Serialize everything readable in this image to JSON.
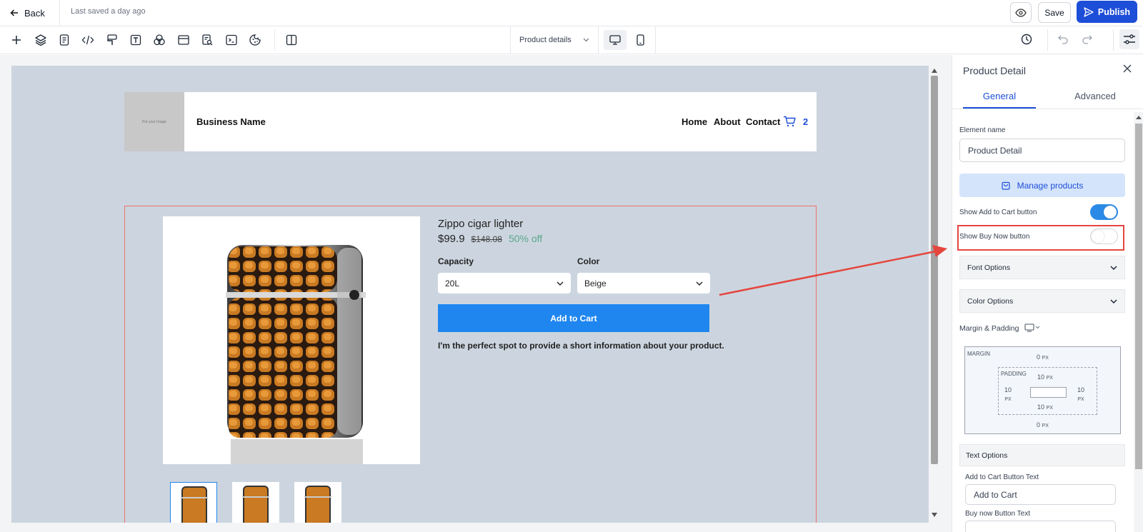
{
  "topbar": {
    "back_label": "Back",
    "last_saved": "Last saved a day ago",
    "save_label": "Save",
    "publish_label": "Publish"
  },
  "toolbar": {
    "tools": [
      "add-icon",
      "layers-icon",
      "pages-icon",
      "code-icon",
      "paint-icon",
      "text-icon",
      "colors-icon",
      "layout-icon",
      "seo-icon",
      "terminal-icon",
      "cookie-icon",
      "split-view-icon"
    ],
    "page_select": "Product details"
  },
  "site": {
    "logo_text": "Put your Image",
    "business_name": "Business Name",
    "nav": [
      "Home",
      "About",
      "Contact"
    ],
    "cart_count": "2"
  },
  "product": {
    "title": "Zippo cigar lighter",
    "price": "$99.9",
    "old_price": "$148.08",
    "discount": "50% off",
    "capacity_label": "Capacity",
    "capacity_value": "20L",
    "color_label": "Color",
    "color_value": "Beige",
    "add_to_cart": "Add to Cart",
    "description": "I'm the perfect spot to provide a short information about your product."
  },
  "panel": {
    "title": "Product Detail",
    "tabs": [
      "General",
      "Advanced"
    ],
    "element_name_label": "Element name",
    "element_name_value": "Product Detail",
    "manage_products": "Manage products",
    "show_add_to_cart": "Show Add to Cart button",
    "show_add_to_cart_on": true,
    "show_buy_now": "Show Buy Now button",
    "show_buy_now_on": false,
    "font_options": "Font Options",
    "color_options": "Color Options",
    "margin_padding": "Margin & Padding",
    "margin_label": "MARGIN",
    "padding_label": "PADDING",
    "margin_top": "0",
    "margin_bottom": "0",
    "padding_top": "10",
    "padding_bottom": "10",
    "padding_left": "10",
    "padding_right": "10",
    "unit": "PX",
    "text_options": "Text Options",
    "add_to_cart_text_label": "Add to Cart Button Text",
    "add_to_cart_text_value": "Add to Cart",
    "buy_now_text_label": "Buy now Button Text"
  },
  "colors": {
    "accent": "#1d4ed8",
    "canvas": "#ccd5df",
    "button": "#1f86f0",
    "highlight": "#e5463e"
  }
}
